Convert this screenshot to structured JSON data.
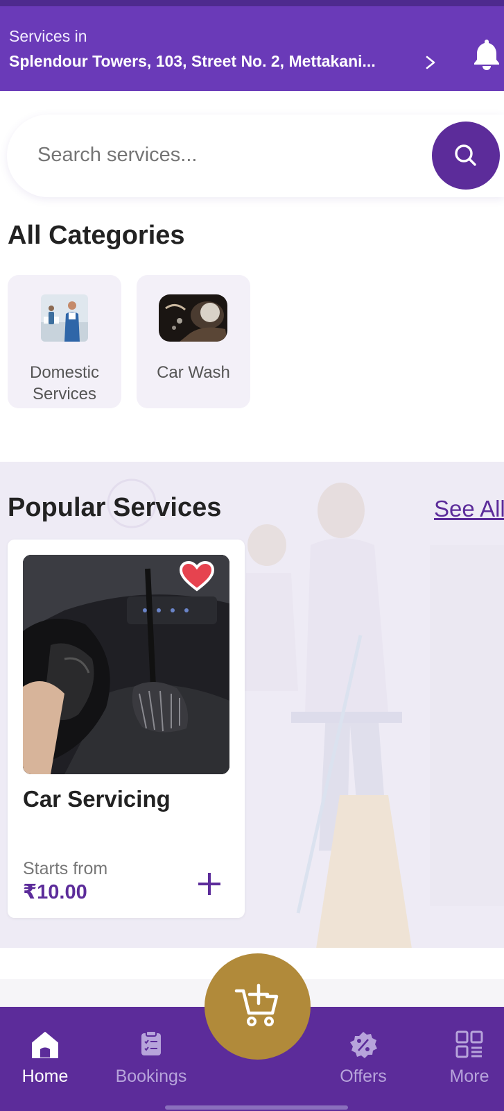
{
  "header": {
    "services_in_label": "Services in",
    "address": "Splendour Towers, 103, Street No. 2, Mettakani...",
    "icons": [
      "chevron-right-icon",
      "bell-icon"
    ]
  },
  "search": {
    "placeholder": "Search services...",
    "icon": "search-icon"
  },
  "categories": {
    "title": "All Categories",
    "items": [
      {
        "name": "Domestic Services"
      },
      {
        "name": "Car Wash"
      }
    ]
  },
  "popular": {
    "title": "Popular Services",
    "see_all": "See All",
    "items": [
      {
        "name": "Car Servicing",
        "starts_from_label": "Starts from",
        "price": "₹10.00",
        "favorite": true
      }
    ]
  },
  "cart_fab": {
    "icon": "cart-add-icon"
  },
  "bottom_nav": {
    "items": [
      {
        "label": "Home",
        "icon": "home-icon",
        "active": true
      },
      {
        "label": "Bookings",
        "icon": "clipboard-icon",
        "active": false
      },
      {
        "label": "Offers",
        "icon": "discount-badge-icon",
        "active": false
      },
      {
        "label": "More",
        "icon": "grid-icon",
        "active": false
      }
    ]
  },
  "colors": {
    "primary": "#6a3ab8",
    "primary_dark": "#5c2c9a",
    "accent_gold": "#b18a3a",
    "category_card_bg": "#f3f0f8"
  }
}
